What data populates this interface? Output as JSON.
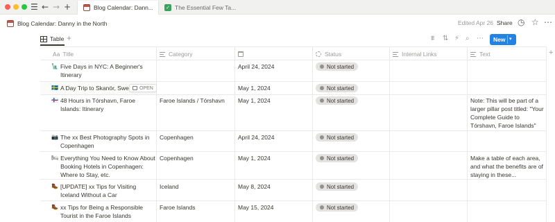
{
  "tabs": [
    {
      "label": "Blog Calendar: Dann...",
      "icon": "calendar-icon"
    },
    {
      "label": "The Essential Few Ta...",
      "icon": "check-icon"
    }
  ],
  "breadcrumb": "Blog Calendar: Danny in the North",
  "header": {
    "edited": "Edited Apr 26",
    "share": "Share"
  },
  "view": {
    "tab_label": "Table",
    "new_label": "New"
  },
  "columns": [
    {
      "label": "Title",
      "prefix": "Aa",
      "icon": "text-type-icon"
    },
    {
      "label": "Category",
      "icon": "list-icon"
    },
    {
      "label": "",
      "icon": "calendar-icon"
    },
    {
      "label": "Status",
      "icon": "status-icon"
    },
    {
      "label": "Internal Links",
      "icon": "list-icon"
    },
    {
      "label": "Text",
      "icon": "list-icon"
    }
  ],
  "open_label": "OPEN",
  "status_color": "#e3e2e0",
  "accent_color": "#2383e2",
  "rows": [
    {
      "emoji": "🗽",
      "title": "Five Days in NYC: A Beginner's Itinerary",
      "category": "",
      "date": "April 24, 2024",
      "status": "Not started",
      "internal_links": "",
      "text": ""
    },
    {
      "emoji": "🇸🇪",
      "title": "A Day Trip to Skanör, Swede",
      "category": "",
      "date": "May 1, 2024",
      "status": "Not started",
      "internal_links": "",
      "text": ""
    },
    {
      "emoji": "🇫🇴",
      "title": "48 Hours in Tórshavn, Faroe Islands: Itinerary",
      "category": "Faroe Islands / Tórshavn",
      "date": "May 1, 2024",
      "status": "Not started",
      "internal_links": "",
      "text": "Note: This will be part of a larger pillar post titled: \"Your Complete Guide to Tórshavn, Faroe Islands\""
    },
    {
      "emoji": "📷",
      "title": "The xx Best Photography Spots in Copenhagen",
      "category": "Copenhagen",
      "date": "April 24, 2024",
      "status": "Not started",
      "internal_links": "",
      "text": ""
    },
    {
      "emoji": "🛏",
      "title": "Everything You Need to Know About Booking Hotels in Copenhagen: Where to Stay, etc.",
      "category": "Copenhagen",
      "date": "May 1, 2024",
      "status": "Not started",
      "internal_links": "",
      "text": "Make a table of each area, and what the benefits are of staying in these..."
    },
    {
      "emoji": "🥾",
      "title": "[UPDATE] xx Tips for Visiting Iceland Without a Car",
      "category": "Iceland",
      "date": "May 8, 2024",
      "status": "Not started",
      "internal_links": "",
      "text": ""
    },
    {
      "emoji": "🥾",
      "title": "xx Tips for Being a Responsible Tourist in the Faroe Islands",
      "category": "Faroe Islands",
      "date": "May 15, 2024",
      "status": "Not started",
      "internal_links": "",
      "text": ""
    }
  ]
}
